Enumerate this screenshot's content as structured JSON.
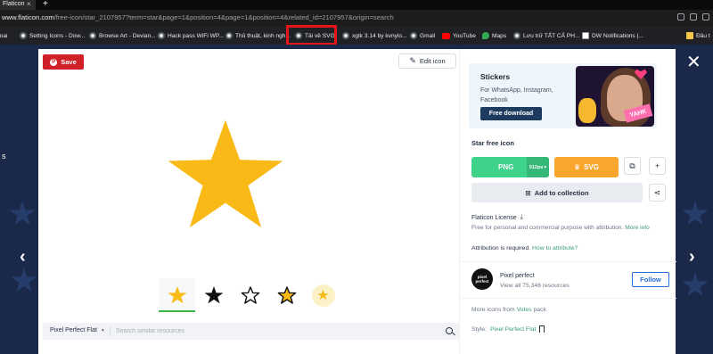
{
  "browser": {
    "tab_title": "Flaticon",
    "tab_close": "×",
    "new_tab": "+",
    "url_host": "www.flaticon.com",
    "url_path": "/free-icon/star_2107957?term=star&page=1&position=4&page=1&position=4&related_id=2107957&origin=search"
  },
  "bookmarks": [
    {
      "label": "hoai",
      "icon": "globe-icon"
    },
    {
      "label": "Setting Icons - Dow...",
      "icon": "globe-icon"
    },
    {
      "label": "Browse Art - Devian...",
      "icon": "globe-icon"
    },
    {
      "label": "Hack pass WiFi WP...",
      "icon": "globe-icon"
    },
    {
      "label": "Thủ thuật, kinh ngh...",
      "icon": "globe-icon"
    },
    {
      "label": "Tải về SVG",
      "icon": "globe-icon"
    },
    {
      "label": "xgtk 3.14 by kvnylo...",
      "icon": "globe-icon"
    },
    {
      "label": "Gmail",
      "icon": "globe-icon"
    },
    {
      "label": "YouTube",
      "icon": "youtube-icon"
    },
    {
      "label": "Maps",
      "icon": "maps-icon"
    },
    {
      "label": "Lưu trữ TẤT CẢ PH...",
      "icon": "globe-icon"
    },
    {
      "label": "DW Notifications |...",
      "icon": "dw-icon"
    },
    {
      "label": "Đầu t",
      "icon": "folder-icon"
    }
  ],
  "backdrop": {
    "side_text": "s"
  },
  "modal": {
    "save_label": "Save",
    "edit_label": "Edit icon",
    "search": {
      "style_label": "Pixel Perfect Flat",
      "placeholder": "Search similar resources"
    },
    "variants": [
      "flat-yellow",
      "filled-black",
      "outline",
      "lineal-color",
      "flat-small"
    ],
    "promo": {
      "title": "Stickers",
      "subtitle": "For WhatsApp, Instagram, Facebook",
      "button": "Free download",
      "sticker_text": "YAHK"
    },
    "icon_title": "Star free icon",
    "png_label": "PNG",
    "png_size": "512px",
    "svg_label": "SVG",
    "collection_label": "Add to collection",
    "license_title": "Flaticon License",
    "license_text": "Free for personal and commercial purpose with attribution.",
    "more_info": "More info",
    "attribution_label": "Attribution is required.",
    "attribution_link": "How to attribute?",
    "author": {
      "avatar_text": "pixel perfect",
      "name": "Pixel perfect",
      "resources": "View all 75,346 resources",
      "follow": "Follow"
    },
    "more_icons_prefix": "More icons from",
    "more_icons_pack": "Votes",
    "more_icons_suffix": "pack",
    "style_prefix": "Style:",
    "style_value": "Pixel Perfect Flat"
  },
  "colors": {
    "save": "#cf2027",
    "png": "#3fd28b",
    "svg": "#f8a62c",
    "star": "#f9b916",
    "link": "#3a9c74",
    "follow": "#2a6fd6",
    "highlight": "#e4141b"
  }
}
